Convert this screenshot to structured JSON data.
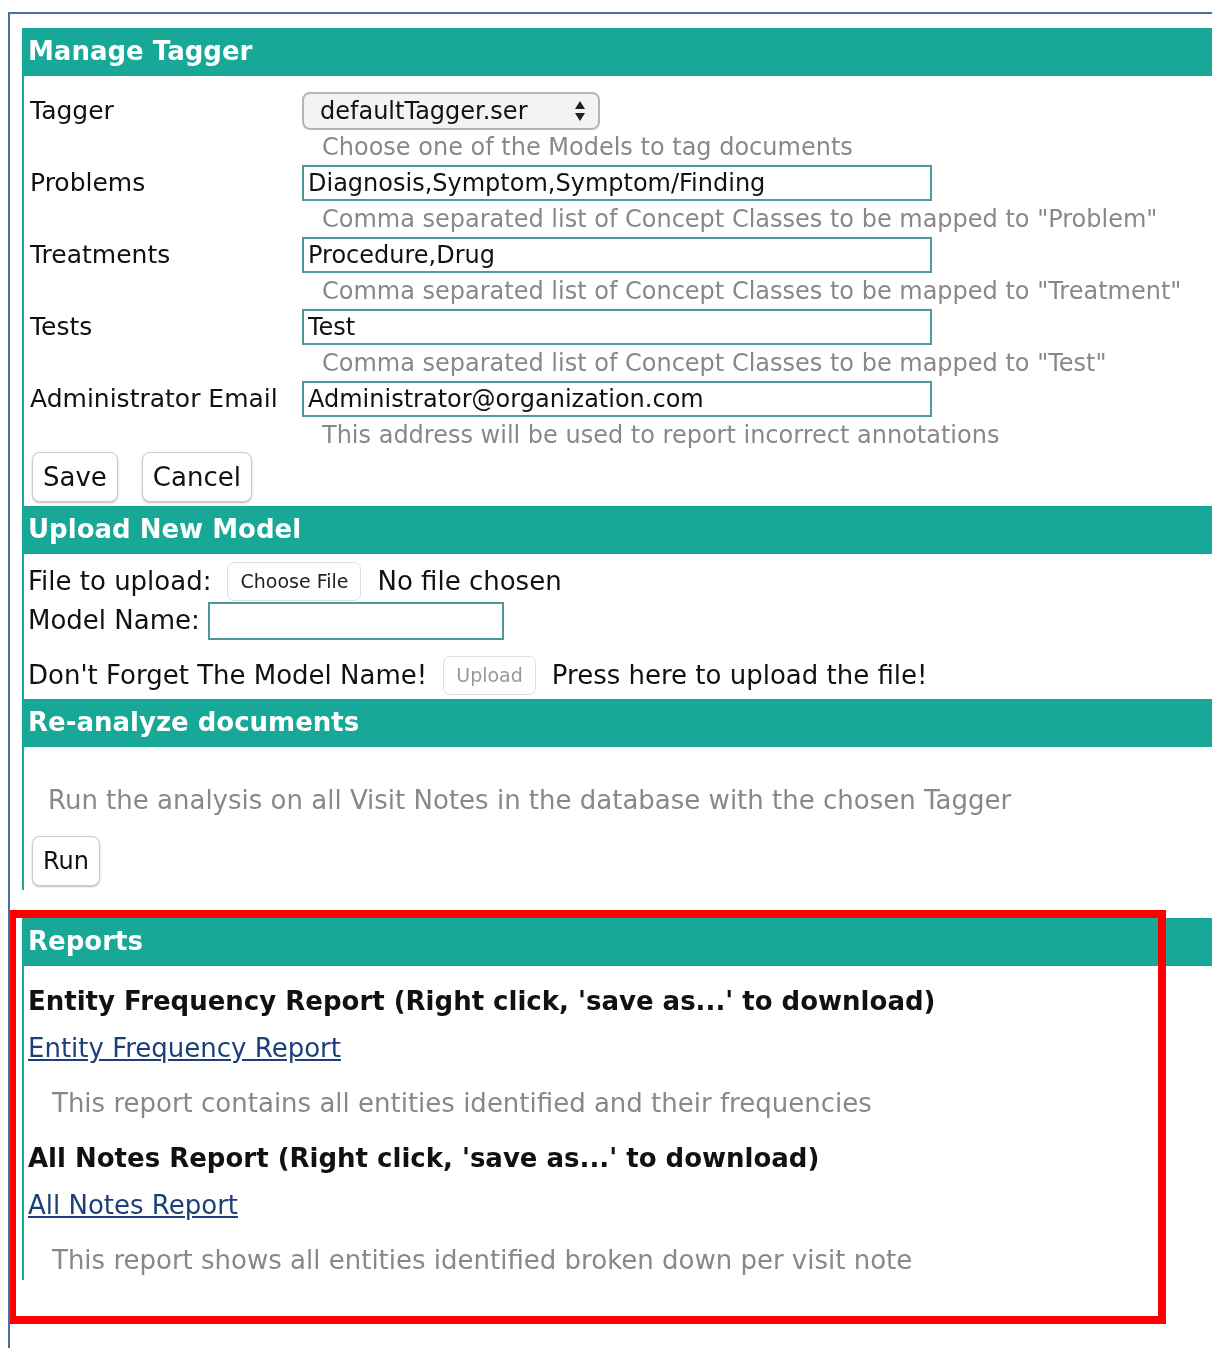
{
  "sections": [
    {
      "kind": "form",
      "title": "Manage Tagger",
      "highlighted": false,
      "fields": [
        {
          "kind": "select",
          "label": "Tagger",
          "value": "defaultTagger.ser",
          "hint": "Choose one of the Models to tag documents"
        },
        {
          "kind": "text",
          "label": "Problems",
          "value": "Diagnosis,Symptom,Symptom/Finding",
          "hint": "Comma separated list of Concept Classes to be mapped to \"Problem\""
        },
        {
          "kind": "text",
          "label": "Treatments",
          "value": "Procedure,Drug",
          "hint": "Comma separated list of Concept Classes to be mapped to \"Treatment\""
        },
        {
          "kind": "text",
          "label": "Tests",
          "value": "Test",
          "hint": "Comma separated list of Concept Classes to be mapped to \"Test\""
        },
        {
          "kind": "text",
          "label": "Administrator Email",
          "value": "Administrator@organization.com",
          "hint": "This address will be used to report incorrect annotations"
        }
      ],
      "buttons": [
        "Save",
        "Cancel"
      ]
    },
    {
      "kind": "upload",
      "title": "Upload New Model",
      "highlighted": false,
      "file_label": "File to upload:",
      "file_button": "Choose File",
      "file_status": "No file chosen",
      "name_label": "Model Name:",
      "reminder": "Don't Forget The Model Name!",
      "upload_button": {
        "label": "Upload",
        "disabled": true
      },
      "upload_hint": "Press here to upload the file!"
    },
    {
      "kind": "action",
      "title": "Re-analyze documents",
      "highlighted": false,
      "description": "Run the analysis on all Visit Notes in the database with the chosen Tagger",
      "button": "Run"
    },
    {
      "kind": "reports",
      "title": "Reports",
      "highlighted": true,
      "reports": [
        {
          "heading": "Entity Frequency Report (Right click, 'save as...' to download)",
          "link": "Entity Frequency Report",
          "description": "This report contains all entities identified and their frequencies"
        },
        {
          "heading": "All Notes Report (Right click, 'save as...' to download)",
          "link": "All Notes Report",
          "description": "This report shows all entities identified broken down per visit note"
        }
      ]
    }
  ]
}
